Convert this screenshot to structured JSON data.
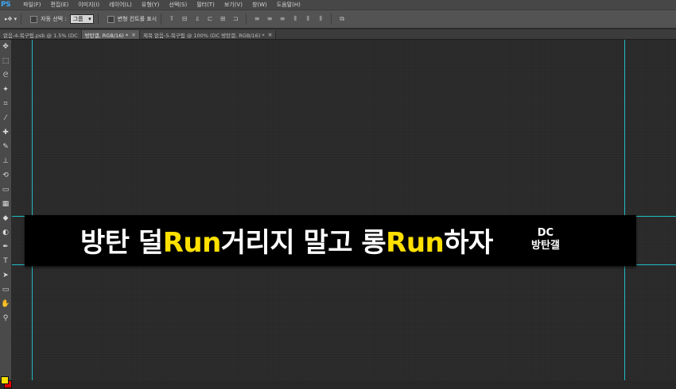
{
  "app": {
    "logo": "PS"
  },
  "menu": [
    "파일(F)",
    "편집(E)",
    "이미지(I)",
    "레이어(L)",
    "유형(Y)",
    "선택(S)",
    "필터(T)",
    "보기(V)",
    "창(W)",
    "도움말(H)"
  ],
  "options": {
    "auto_select_label": "자동 선택 :",
    "auto_select_value": "그룹",
    "transform_controls_label": "변형 컨트롤 표시"
  },
  "tabs": [
    {
      "label": "없음-4-복구됨.psb @ 1.5% (DC",
      "active": false
    },
    {
      "label": "방탄갤, RGB/16) *",
      "active": true
    },
    {
      "label": "제목 없음-5-복구됨 @ 100% (DC 방탄갤, RGB/16) *",
      "active": false
    }
  ],
  "tab_close_glyph": "×",
  "tools": [
    "move-icon",
    "marquee-icon",
    "lasso-icon",
    "magic-wand-icon",
    "crop-icon",
    "eyedropper-icon",
    "healing-brush-icon",
    "brush-icon",
    "stamp-icon",
    "history-brush-icon",
    "eraser-icon",
    "gradient-icon",
    "blur-icon",
    "dodge-icon",
    "pen-icon",
    "type-icon",
    "path-select-icon",
    "shape-icon",
    "hand-icon",
    "zoom-icon"
  ],
  "tool_glyphs": [
    "✥",
    "⬚",
    "ᘓ",
    "✦",
    "⌗",
    "⁄",
    "✚",
    "✎",
    "⊥",
    "⟲",
    "▭",
    "▦",
    "◆",
    "◐",
    "✒",
    "T",
    "➤",
    "▭",
    "✋",
    "⚲"
  ],
  "colors": {
    "foreground": "#f7e000",
    "background": "#e30000",
    "guide": "#1fd6e0",
    "accent_text": "#ffe000"
  },
  "canvas": {
    "banner_parts": [
      {
        "text": "방탄 덜",
        "highlight": false
      },
      {
        "text": "Run",
        "highlight": true
      },
      {
        "text": "거리지 말고 롱",
        "highlight": false
      },
      {
        "text": "Run",
        "highlight": true
      },
      {
        "text": "하자",
        "highlight": false
      }
    ],
    "signature_top": "DC",
    "signature_bottom": "방탄갤"
  }
}
